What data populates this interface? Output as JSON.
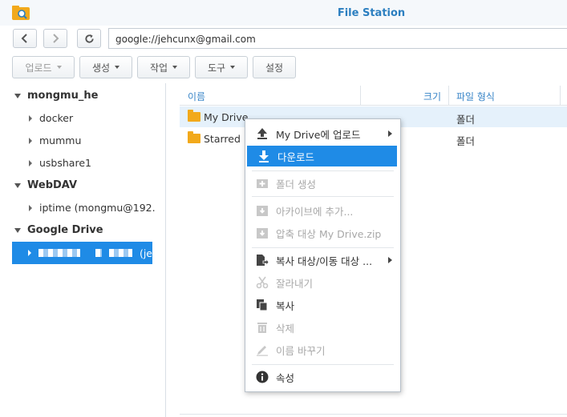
{
  "window": {
    "title": "File Station"
  },
  "nav": {
    "path": "google://jehcunx@gmail.com"
  },
  "toolbar": {
    "upload": "업로드",
    "create": "생성",
    "action": "작업",
    "tools": "도구",
    "settings": "설정"
  },
  "sidebar": {
    "groups": [
      {
        "label": "mongmu_he",
        "items": [
          "docker",
          "mummu",
          "usbshare1"
        ]
      },
      {
        "label": "WebDAV",
        "items": [
          "iptime (mongmu@192."
        ]
      },
      {
        "label": "Google Drive",
        "selected_suffix": "(je"
      }
    ]
  },
  "table": {
    "headers": {
      "name": "이름",
      "size": "크기",
      "type": "파일 형식"
    },
    "rows": [
      {
        "name": "My Drive",
        "type": "폴더"
      },
      {
        "name": "Starred",
        "type": "폴더"
      }
    ]
  },
  "context_menu": {
    "upload_to": "My Drive에 업로드",
    "download": "다운로드",
    "create_folder": "폴더 생성",
    "add_to_archive": "아카이브에 추가...",
    "compress_to": "압축 대상 My Drive.zip",
    "copy_move_to": "복사 대상/이동 대상 ...",
    "cut": "잘라내기",
    "copy": "복사",
    "delete": "삭제",
    "rename": "이름 바꾸기",
    "properties": "속성"
  },
  "colors": {
    "accent": "#1f8be6",
    "title": "#2c7fc0",
    "folder": "#f2a91b"
  }
}
